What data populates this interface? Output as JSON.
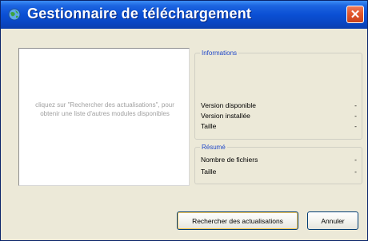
{
  "window": {
    "title": "Gestionnaire de téléchargement",
    "close_symbol": "✕",
    "icon": "globe-icon"
  },
  "left_panel": {
    "hint": "cliquez sur \"Rechercher des actualisations\", pour obtenir une liste d'autres modules disponibles"
  },
  "informations": {
    "title": "Informations",
    "rows": [
      {
        "label": "Version disponible",
        "value": "-"
      },
      {
        "label": "Version installée",
        "value": "-"
      },
      {
        "label": "Taille",
        "value": "-"
      }
    ]
  },
  "resume": {
    "title": "Résumé",
    "rows": [
      {
        "label": "Nombre de fichiers",
        "value": "-"
      },
      {
        "label": "Taille",
        "value": "-"
      }
    ]
  },
  "buttons": {
    "search_label": "Rechercher des actualisations",
    "cancel_label": "Annuler"
  },
  "colors": {
    "titlebar": "#0a4fd4",
    "group_title": "#1f47c8",
    "close_button": "#e2572c"
  }
}
